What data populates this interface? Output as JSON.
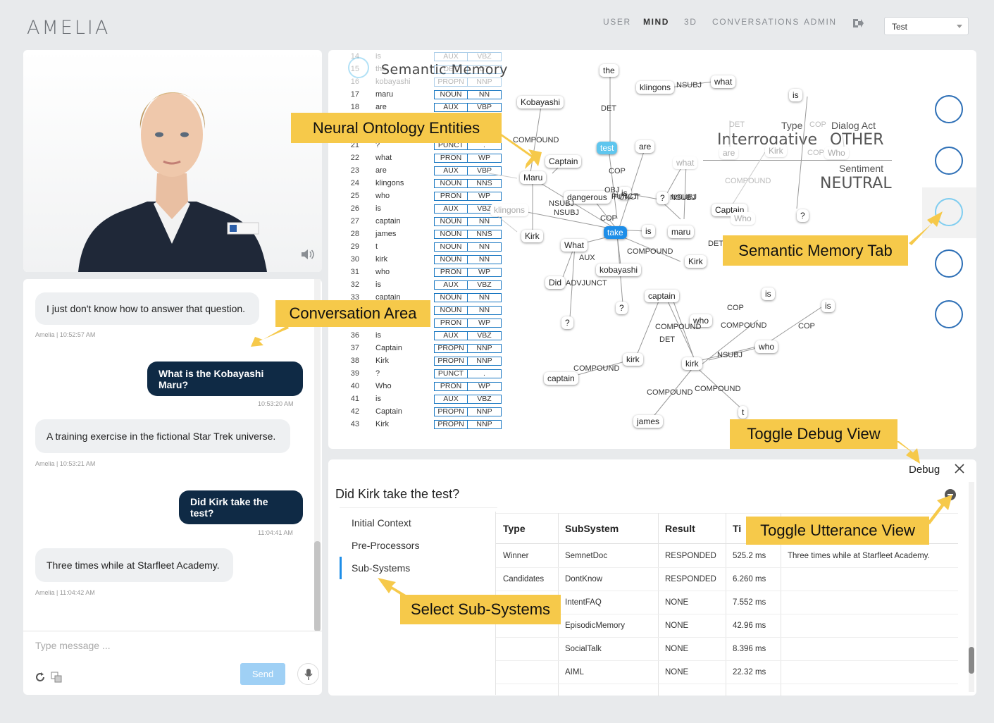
{
  "header": {
    "logo": "AMELIA",
    "nav": [
      "USER",
      "MIND",
      "3D",
      "CONVERSATIONS",
      "ADMIN"
    ],
    "active_nav": "MIND",
    "dropdown_value": "Test"
  },
  "chat": {
    "messages": [
      {
        "from": "amelia",
        "text": "I just don't know how to answer that question.",
        "meta": "Amelia | 10:52:57 AM"
      },
      {
        "from": "user",
        "text": "What is the Kobayashi Maru?",
        "meta": "10:53:20 AM"
      },
      {
        "from": "amelia",
        "text": "A training exercise in the fictional Star Trek universe.",
        "meta": "Amelia | 10:53:21 AM"
      },
      {
        "from": "user",
        "text": "Did Kirk take the test?",
        "meta": "11:04:41 AM"
      },
      {
        "from": "amelia",
        "text": "Three times while at Starfleet Academy.",
        "meta": "Amelia | 11:04:42 AM"
      }
    ],
    "input_placeholder": "Type message ...",
    "send_label": "Send"
  },
  "mind": {
    "title": "Semantic Memory",
    "tokens": [
      [
        "14",
        "is",
        "AUX",
        "VBZ"
      ],
      [
        "15",
        "the",
        "DET",
        "DT"
      ],
      [
        "16",
        "kobayashi",
        "PROPN",
        "NNP"
      ],
      [
        "17",
        "maru",
        "NOUN",
        "NN"
      ],
      [
        "18",
        "are",
        "AUX",
        "VBP"
      ],
      [
        "19",
        "",
        "",
        ""
      ],
      [
        "20",
        "",
        "",
        ""
      ],
      [
        "21",
        "?",
        "PUNCT",
        "."
      ],
      [
        "22",
        "what",
        "PRON",
        "WP"
      ],
      [
        "23",
        "are",
        "AUX",
        "VBP"
      ],
      [
        "24",
        "klingons",
        "NOUN",
        "NNS"
      ],
      [
        "25",
        "who",
        "PRON",
        "WP"
      ],
      [
        "26",
        "is",
        "AUX",
        "VBZ"
      ],
      [
        "27",
        "captain",
        "NOUN",
        "NN"
      ],
      [
        "28",
        "james",
        "NOUN",
        "NNS"
      ],
      [
        "29",
        "t",
        "NOUN",
        "NN"
      ],
      [
        "30",
        "kirk",
        "NOUN",
        "NN"
      ],
      [
        "31",
        "who",
        "PRON",
        "WP"
      ],
      [
        "32",
        "is",
        "AUX",
        "VBZ"
      ],
      [
        "33",
        "captain",
        "NOUN",
        "NN"
      ],
      [
        "34",
        "",
        "NOUN",
        "NN"
      ],
      [
        "35",
        "",
        "PRON",
        "WP"
      ],
      [
        "36",
        "is",
        "AUX",
        "VBZ"
      ],
      [
        "37",
        "Captain",
        "PROPN",
        "NNP"
      ],
      [
        "38",
        "Kirk",
        "PROPN",
        "NNP"
      ],
      [
        "39",
        "?",
        "PUNCT",
        "."
      ],
      [
        "40",
        "Who",
        "PRON",
        "WP"
      ],
      [
        "41",
        "is",
        "AUX",
        "VBZ"
      ],
      [
        "42",
        "Captain",
        "PROPN",
        "NNP"
      ],
      [
        "43",
        "Kirk",
        "PROPN",
        "NNP"
      ]
    ],
    "type_label": "Type",
    "type_value": "Interrogative",
    "dialog_act_label": "Dialog Act",
    "dialog_act_value": "OTHER",
    "sentiment_label": "Sentiment",
    "sentiment_value": "NEUTRAL",
    "nodes": [
      "the",
      "klingons",
      "what",
      "Kobayashi",
      "is",
      "test",
      "are",
      "Captain",
      "what",
      "Maru",
      "dangerous",
      "is",
      "?",
      "Captain",
      "klingons",
      "?",
      "Kirk",
      "take",
      "is",
      "maru",
      "What",
      "kobayashi",
      "Kirk",
      "Did",
      "captain",
      "is",
      "?",
      "?",
      "who",
      "is",
      "who",
      "kirk",
      "kirk",
      "captain",
      "t",
      "james",
      "are",
      "Kirk",
      "Who",
      "Who"
    ],
    "edges": [
      "NSUBJ",
      "DET",
      "COMPOUND",
      "COP",
      "DET",
      "COP",
      "COP",
      "COMPOUND",
      "NSUBJ",
      "NSUBJ",
      "OBJ",
      "PUNCT",
      "COP",
      "AUX",
      "COMPOUND",
      "NSUBJ",
      "DET",
      "ADVJUNCT",
      "COP",
      "COMPOUND",
      "DET",
      "COP",
      "NSUBJ",
      "COMPOUND",
      "COMPOUND",
      "COMPOUND",
      "COMPOUND",
      "NSUBJ",
      "PUNCT"
    ]
  },
  "debug": {
    "header_label": "Debug",
    "utterance": "Did Kirk take the test?",
    "nav": [
      "Initial Context",
      "Pre-Processors",
      "Sub-Systems"
    ],
    "active_nav": "Sub-Systems",
    "columns": [
      "Type",
      "SubSystem",
      "Result",
      "Ti"
    ],
    "rows": [
      [
        "Winner",
        "SemnetDoc",
        "RESPONDED",
        "525.2 ms",
        "Three times while at Starfleet Academy."
      ],
      [
        "Candidates",
        "DontKnow",
        "RESPONDED",
        "6.260 ms",
        ""
      ],
      [
        "",
        "IntentFAQ",
        "NONE",
        "7.552 ms",
        ""
      ],
      [
        "",
        "EpisodicMemory",
        "NONE",
        "42.96 ms",
        ""
      ],
      [
        "",
        "SocialTalk",
        "NONE",
        "8.396 ms",
        ""
      ],
      [
        "",
        "AIML",
        "NONE",
        "22.32 ms",
        ""
      ]
    ]
  },
  "annotations": {
    "neural": "Neural Ontology Entities",
    "conversation": "Conversation Area",
    "semantic_tab": "Semantic Memory Tab",
    "toggle_debug": "Toggle Debug View",
    "toggle_utterance": "Toggle Utterance View",
    "select_subsystems": "Select Sub-Systems"
  },
  "colors": {
    "accent_blue": "#1e8ee8",
    "navy": "#0f2a45",
    "annotation_yellow": "#f6c94a",
    "send_disabled": "#9fd0f5"
  }
}
